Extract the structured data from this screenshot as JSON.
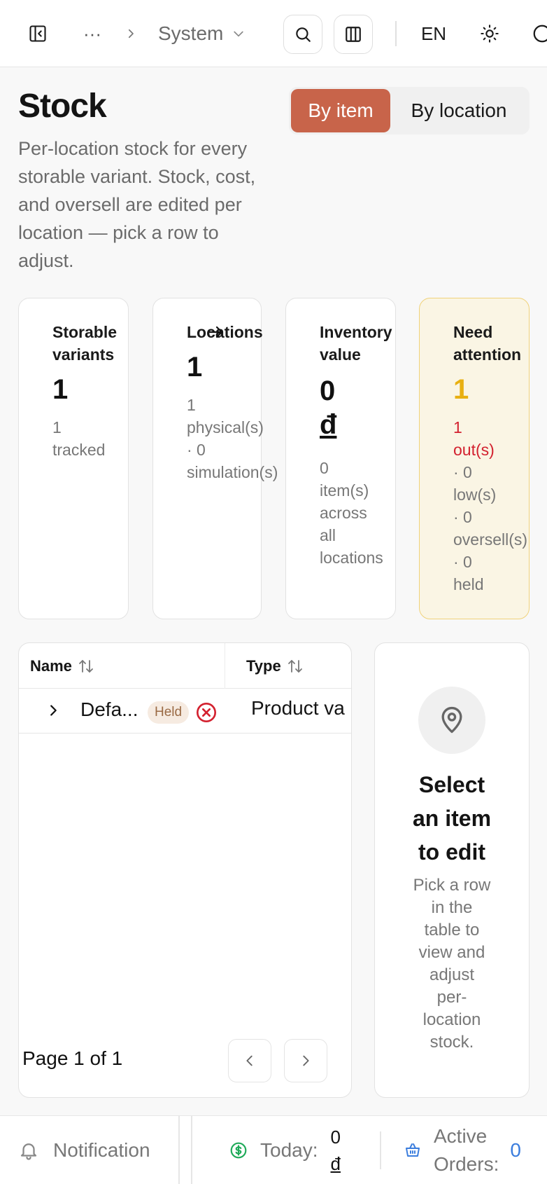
{
  "topbar": {
    "breadcrumb_more": "···",
    "breadcrumb_current": "System",
    "language": "EN"
  },
  "header": {
    "title": "Stock",
    "view_toggle": {
      "by_item": "By item",
      "by_location": "By location",
      "selected": "By item"
    },
    "description": "Per-location stock for every storable variant. Stock, cost, and oversell are edited per location — pick a row to adjust."
  },
  "stats": {
    "storable": {
      "label_1": "Storable",
      "label_2": "variants",
      "value": "1",
      "sub_1": "1",
      "sub_2": "tracked"
    },
    "locations": {
      "label": "Locations",
      "value": "1",
      "sub_1": "1",
      "sub_2": "physical(s)",
      "sub_3": "· 0",
      "sub_4": "simulation(s)"
    },
    "inventory": {
      "label_1": "Inventory",
      "label_2": "value",
      "value": "0",
      "currency": "đ",
      "sub_1": "0",
      "sub_2": "item(s)",
      "sub_3": "across",
      "sub_4": "all",
      "sub_5": "locations"
    },
    "attention": {
      "label_1": "Need",
      "label_2": "attention",
      "value": "1",
      "sub_1": "1",
      "sub_2": "out(s)",
      "sub_3": "· 0",
      "sub_4": "low(s)",
      "sub_5": "· 0",
      "sub_6": "oversell(s)",
      "sub_7": "· 0",
      "sub_8": "held",
      "accent": "#e8b012",
      "alert_color": "#d3212f"
    }
  },
  "table": {
    "columns": [
      "Name",
      "Type"
    ],
    "rows": [
      {
        "name": "Defa...",
        "badge": "Held",
        "type": "Product va"
      }
    ],
    "pagination": "Page 1 of 1"
  },
  "side_panel": {
    "title_1": "Select",
    "title_2": "an item",
    "title_3": "to edit",
    "desc_1": "Pick a row",
    "desc_2": "in the",
    "desc_3": "table to",
    "desc_4": "view and",
    "desc_5": "adjust",
    "desc_6": "per-",
    "desc_7": "location",
    "desc_8": "stock."
  },
  "statusbar": {
    "notification": "Notification",
    "today_label": "Today:",
    "today_value": "0",
    "today_currency": "đ",
    "active_orders_1": "Active",
    "active_orders_2": "Orders:",
    "active_orders_value": "0",
    "today_icon_color": "#1faa59",
    "orders_icon_color": "#3b7ddd"
  },
  "colors": {
    "brand": "#c8644a",
    "error": "#d3212f"
  }
}
